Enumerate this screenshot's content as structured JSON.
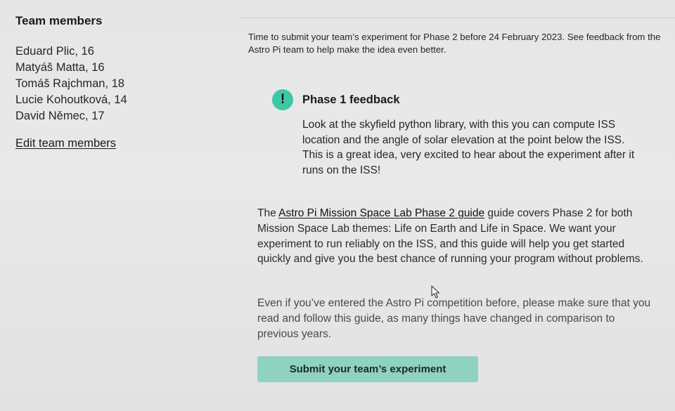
{
  "sidebar": {
    "title": "Team members",
    "members": [
      "Eduard Plic, 16",
      "Matyáš Matta, 16",
      "Tomáš Rajchman, 18",
      "Lucie Kohoutková, 14",
      "David Němec, 17"
    ],
    "edit_label": "Edit team members"
  },
  "main": {
    "deadline_text": "Time to submit your team’s experiment for Phase 2 before 24 February 2023. See feedback from the Astro Pi team to help make the idea even better.",
    "feedback": {
      "icon_glyph": "!",
      "icon_color": "#3ec7a6",
      "title": "Phase 1 feedback",
      "body": "Look at the skyfield python library, with this you can compute ISS location and the angle of solar elevation at the point below the ISS. This is a great idea, very excited to hear about the experiment after it runs on the ISS!"
    },
    "guide": {
      "prefix": "The ",
      "link_text": "Astro Pi Mission Space Lab Phase 2 guide",
      "suffix": " guide covers Phase 2 for both Mission Space Lab themes: Life on Earth and Life in Space. We want your experiment to run reliably on the ISS, and this guide will help you get started quickly and give you the best chance of running your program without problems."
    },
    "previous_note": "Even if you’ve entered the Astro Pi competition before, please make sure that you read and follow this guide, as many things have changed in comparison to previous years.",
    "submit_label": "Submit your team’s experiment",
    "submit_color": "#8fd2c2"
  },
  "cursor": {
    "icon": "mouse-pointer-icon"
  }
}
